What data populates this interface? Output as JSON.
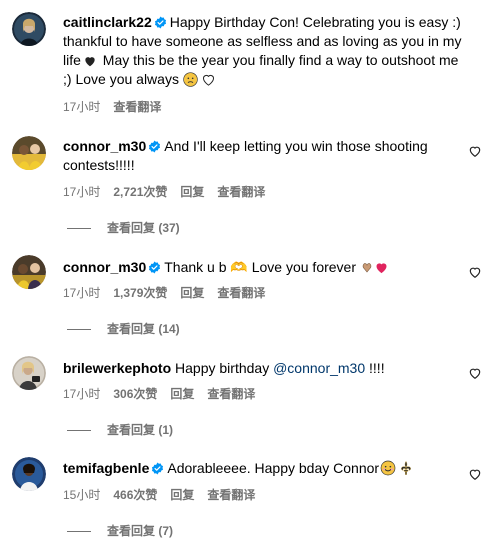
{
  "caption": {
    "username": "caitlinclark22",
    "text": "Happy Birthday Con! Celebrating you is easy :) thankful to have someone as selfless and as loving as you in my life",
    "text2": " May this be the year you finally find a way to outshoot me ;) Love you always ",
    "time": "17小时",
    "translate": "查看翻译"
  },
  "comments": [
    {
      "username": "connor_m30",
      "text": "And I'll keep letting you win those shooting contests!!!!!",
      "time": "17小时",
      "likes": "2,721次赞",
      "reply": "回复",
      "translate": "查看翻译",
      "view_replies": "查看回复 (37)"
    },
    {
      "username": "connor_m30",
      "text": "Thank u b 🫶 Love you forever ",
      "time": "17小时",
      "likes": "1,379次赞",
      "reply": "回复",
      "translate": "查看翻译",
      "view_replies": "查看回复 (14)"
    },
    {
      "username": "brilewerkephoto",
      "text_before": "Happy birthday ",
      "mention": "@connor_m30",
      "text_after": " !!!!",
      "time": "17小时",
      "likes": "306次赞",
      "reply": "回复",
      "translate": "查看翻译",
      "view_replies": "查看回复 (1)"
    },
    {
      "username": "temifagbenle",
      "text": "Adorableeee. Happy bday Connor",
      "time": "15小时",
      "likes": "466次赞",
      "reply": "回复",
      "translate": "查看翻译",
      "view_replies": "查看回复 (7)"
    }
  ],
  "colors": {
    "verified": "#0095f6",
    "meta": "#737373",
    "mention": "#00376b"
  },
  "icons": [
    "verified-badge-icon",
    "black-heart-icon",
    "heart-outline-icon",
    "sad-face-icon",
    "like-heart-icon",
    "heart-hands-icon",
    "red-heart-icon",
    "smiling-face-icon",
    "fleur-de-lis-icon"
  ]
}
